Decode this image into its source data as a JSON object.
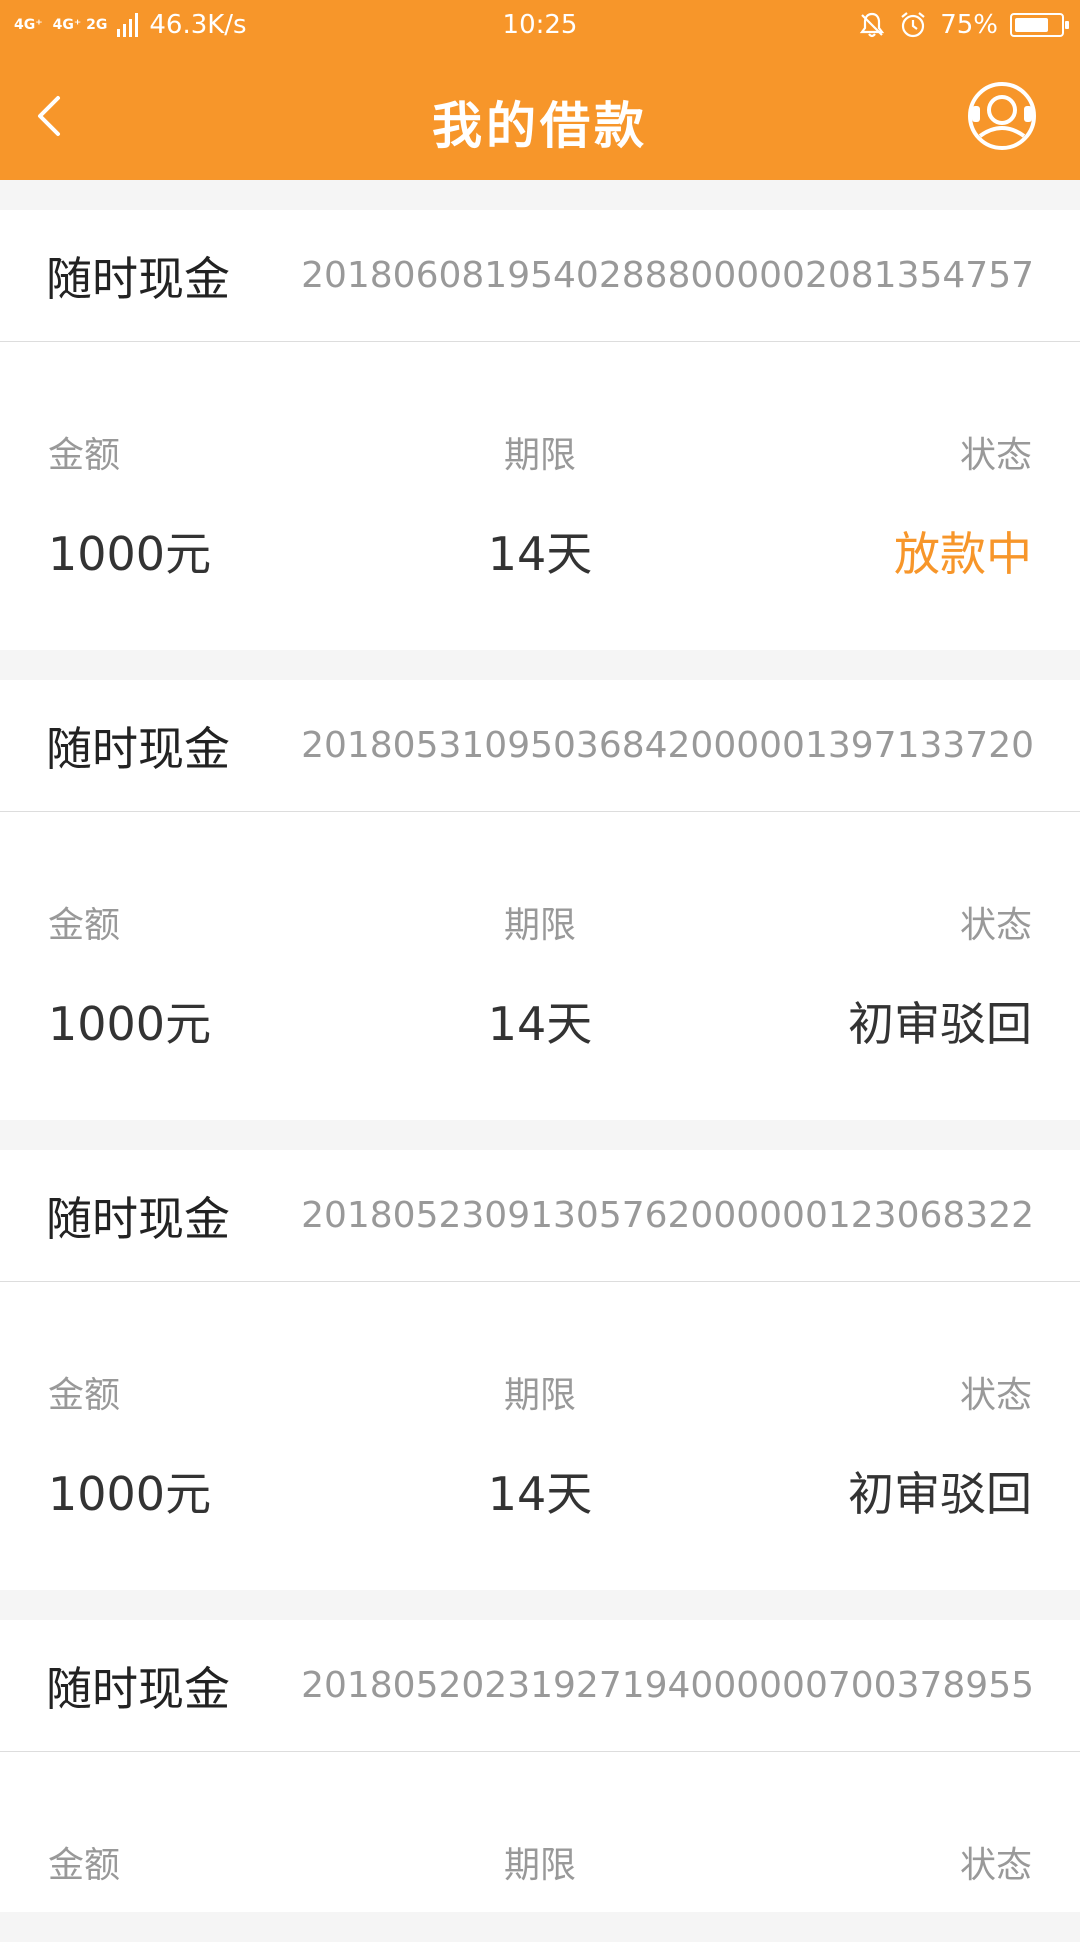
{
  "status_bar": {
    "network_1": "4G⁺",
    "network_2": "4G⁺ 2G",
    "speed": "46.3K/s",
    "time": "10:25",
    "battery": "75%",
    "battery_level": 0.75
  },
  "header": {
    "title": "我的借款"
  },
  "labels": {
    "amount": "金额",
    "term": "期限",
    "status": "状态"
  },
  "colors": {
    "brand": "#f7962a",
    "accent_status": "#f7962a"
  },
  "loans": [
    {
      "product": "随时现金",
      "order_no": "20180608195402888000002081354757",
      "amount": "1000元",
      "term": "14天",
      "status": "放款中",
      "status_accent": true
    },
    {
      "product": "随时现金",
      "order_no": "20180531095036842000001397133720",
      "amount": "1000元",
      "term": "14天",
      "status": "初审驳回",
      "status_accent": false
    },
    {
      "product": "随时现金",
      "order_no": "20180523091305762000000123068322",
      "amount": "1000元",
      "term": "14天",
      "status": "初审驳回",
      "status_accent": false
    },
    {
      "product": "随时现金",
      "order_no": "20180520231927194000000700378955",
      "amount": "",
      "term": "",
      "status": ""
    }
  ]
}
